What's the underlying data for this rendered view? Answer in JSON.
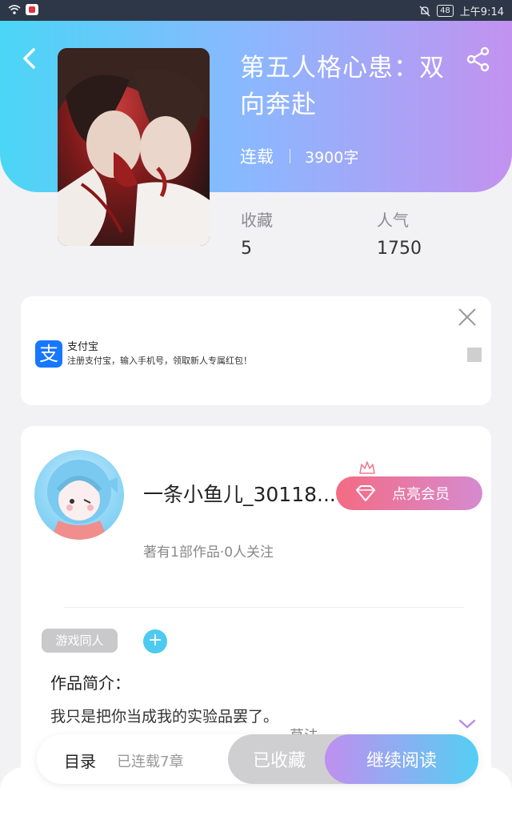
{
  "status_bar": {
    "time": "上午9:14",
    "battery": "48"
  },
  "book": {
    "title": "第五人格心患：双向奔赴",
    "status": "连载",
    "word_count": "3900字",
    "favorites_label": "收藏",
    "favorites_value": "5",
    "popularity_label": "人气",
    "popularity_value": "1750"
  },
  "ad": {
    "brand": "支付宝",
    "logo_char": "支",
    "text": "注册支付宝，输入手机号，领取新人专属红包！"
  },
  "author": {
    "name": "一条小鱼儿_30118...",
    "stats": "著有1部作品·0人关注",
    "vip_label": "点亮会员"
  },
  "tags": [
    "游戏同人"
  ],
  "intro": {
    "heading": "作品简介：",
    "text": "我只是把你当成我的实验品罢了。",
    "partial_hidden": "草法"
  },
  "bottom": {
    "toc_label": "目录",
    "chapters_label": "已连载7章",
    "favorited_label": "已收藏",
    "continue_label": "继续阅读"
  },
  "colors": {
    "header_start": "#4ad6f5",
    "header_end": "#c292ef",
    "vip_start": "#f46b83",
    "vip_end": "#d58bd0",
    "tag_bg": "#c9c9cc",
    "add_tag_bg": "#4ccaf0"
  }
}
